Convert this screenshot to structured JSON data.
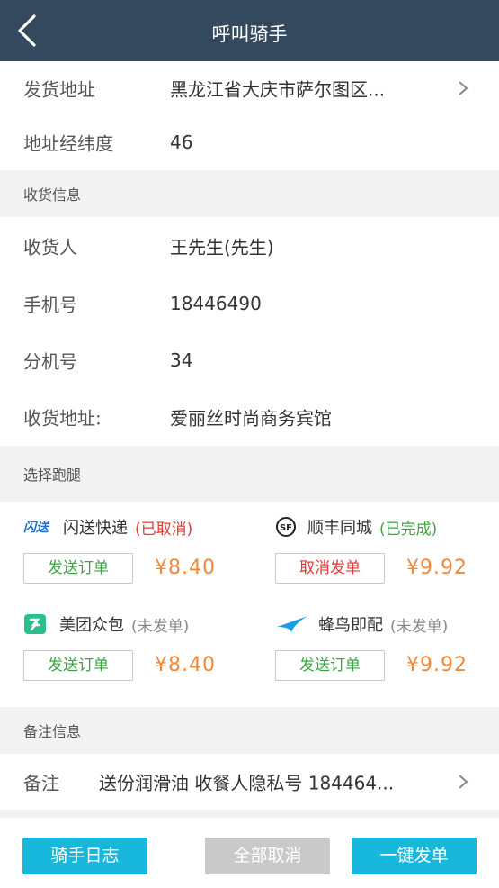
{
  "header": {
    "title": "呼叫骑手"
  },
  "sender": {
    "address_label": "发货地址",
    "address_value": "黑龙江省大庆市萨尔图区...",
    "coords_label": "地址经纬度",
    "coords_value": "46"
  },
  "receiver": {
    "section_title": "收货信息",
    "name_label": "收货人",
    "name_value": "王先生(先生)",
    "phone_label": "手机号",
    "phone_value": "18446490",
    "ext_label": "分机号",
    "ext_value": "34",
    "address_label": "收货地址:",
    "address_value": "爱丽丝时尚商务宾馆"
  },
  "riders": {
    "section_title": "选择跑腿",
    "items": [
      {
        "name": "闪送快递",
        "logo_text": "闪送",
        "status": "(已取消)",
        "button": "发送订单",
        "price": "¥8.40"
      },
      {
        "name": "顺丰同城",
        "logo_text": "SF",
        "status": "(已完成)",
        "button": "取消发单",
        "price": "¥9.92"
      },
      {
        "name": "美团众包",
        "status": "(未发单)",
        "button": "发送订单",
        "price": "¥8.40"
      },
      {
        "name": "蜂鸟即配",
        "status": "(未发单)",
        "button": "发送订单",
        "price": "¥9.92"
      }
    ]
  },
  "notes": {
    "section_title": "备注信息",
    "label": "备注",
    "value": "送份润滑油 收餐人隐私号 184464..."
  },
  "footer": {
    "log_button": "骑手日志",
    "cancel_all_button": "全部取消",
    "dispatch_button": "一键发单"
  },
  "colors": {
    "navbar": "#34495e",
    "accent_blue": "#18b8dd",
    "status_cancelled": "#e53935",
    "status_completed": "#3aa740",
    "price_orange": "#f08a3a"
  },
  "icons": {
    "back": "chevron-left-icon",
    "row_arrow": "chevron-right-icon",
    "shansong_logo": "shansong-logo-icon",
    "sf_logo": "sf-logo-icon",
    "meituan_logo": "meituan-logo-icon",
    "fengniao_logo": "fengniao-logo-icon"
  }
}
